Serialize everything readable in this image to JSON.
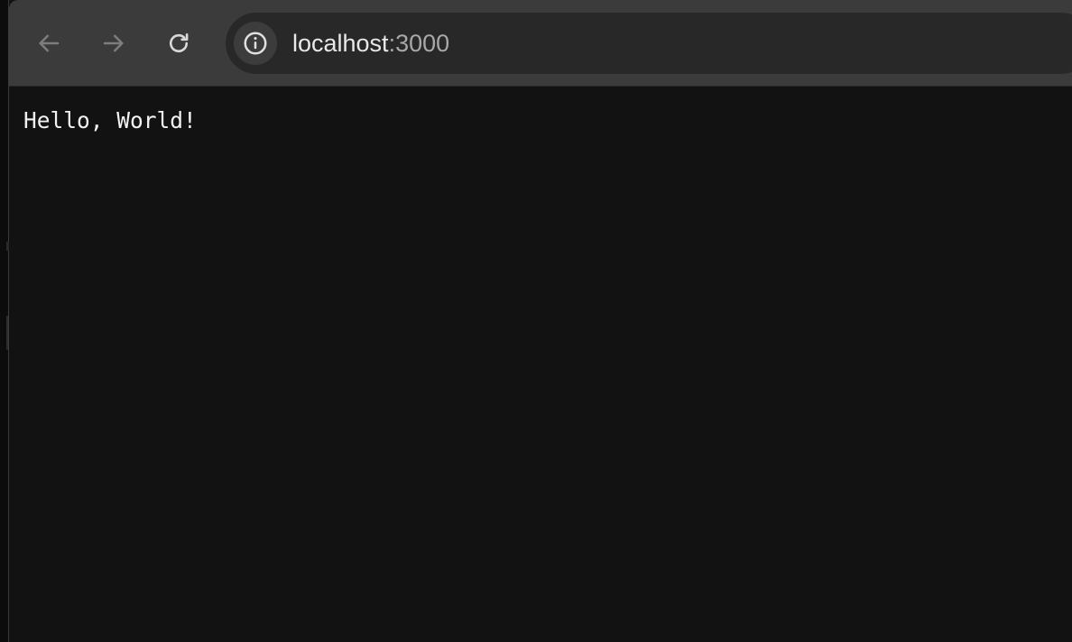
{
  "toolbar": {
    "back_icon": "arrow-left-icon",
    "forward_icon": "arrow-right-icon",
    "reload_icon": "reload-icon",
    "site_info_icon": "info-circle-icon"
  },
  "address_bar": {
    "host": "localhost",
    "port": ":3000"
  },
  "page": {
    "body_text": "Hello, World!"
  },
  "colors": {
    "toolbar_bg": "#3b3b3b",
    "omnibox_bg": "#282828",
    "page_bg": "#121212",
    "text": "#f2f2f2"
  }
}
